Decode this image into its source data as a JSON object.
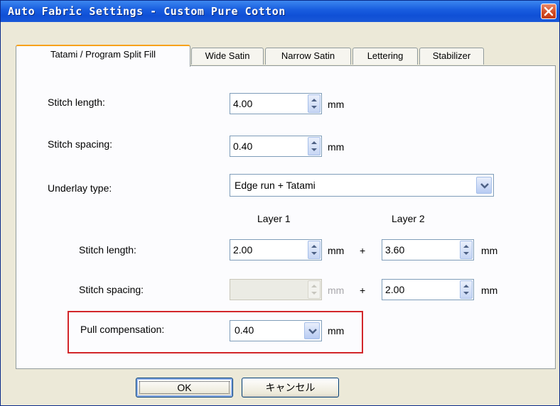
{
  "window": {
    "title": "Auto Fabric Settings - Custom Pure Cotton"
  },
  "tabs": [
    {
      "label": "Tatami / Program Split Fill",
      "active": true
    },
    {
      "label": "Wide Satin",
      "active": false
    },
    {
      "label": "Narrow Satin",
      "active": false
    },
    {
      "label": "Lettering",
      "active": false
    },
    {
      "label": "Stabilizer",
      "active": false
    }
  ],
  "form": {
    "stitch_length_label": "Stitch length:",
    "stitch_length_value": "4.00",
    "stitch_spacing_label": "Stitch spacing:",
    "stitch_spacing_value": "0.40",
    "unit": "mm",
    "underlay_type_label": "Underlay type:",
    "underlay_type_value": "Edge run + Tatami",
    "layer1_header": "Layer 1",
    "layer2_header": "Layer 2",
    "plus": "+",
    "underlay_stitch_length_label": "Stitch length:",
    "underlay_l1_length": "2.00",
    "underlay_l2_length": "3.60",
    "underlay_stitch_spacing_label": "Stitch spacing:",
    "underlay_l1_spacing": "",
    "underlay_l2_spacing": "2.00",
    "pull_comp_label": "Pull compensation:",
    "pull_comp_value": "0.40"
  },
  "buttons": {
    "ok": "OK",
    "cancel": "キャンセル"
  },
  "colors": {
    "accent_tab": "#f7a21a",
    "highlight_box": "#d2262a",
    "titlebar": "#1a5fe0"
  }
}
